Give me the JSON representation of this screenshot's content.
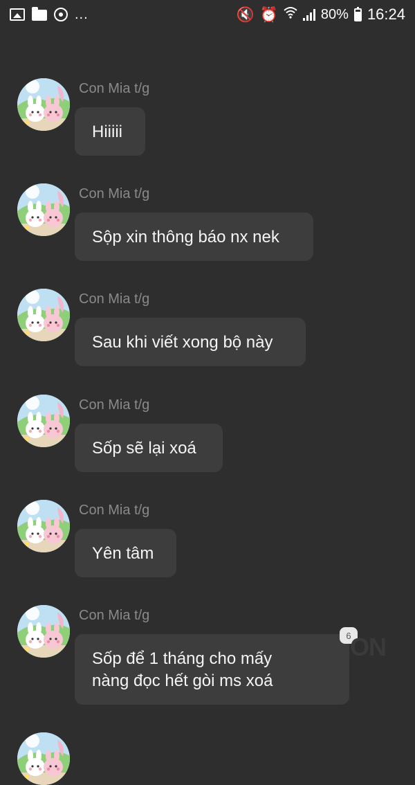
{
  "status_bar": {
    "time": "16:24",
    "battery_percent": "80%",
    "battery_level": 0.8,
    "overflow_indicator": "...",
    "left_icons": [
      "image-icon",
      "folder-icon",
      "chat-icon"
    ],
    "right_icons": [
      "mute-icon",
      "alarm-icon",
      "wifi-icon",
      "signal-icon",
      "battery-icon"
    ]
  },
  "messages": [
    {
      "sender": "Con Mia t/g",
      "text": "Hiiiii"
    },
    {
      "sender": "Con Mia t/g",
      "text": "Sộp xin thông báo nx nek"
    },
    {
      "sender": "Con Mia t/g",
      "text": "Sau khi viết xong bộ này"
    },
    {
      "sender": "Con Mia t/g",
      "text": "Sốp sẽ lại xoá"
    },
    {
      "sender": "Con Mia t/g",
      "text": "Yên tâm"
    },
    {
      "sender": "Con Mia t/g",
      "text": "Sốp để 1 tháng cho mấy\nnàng đọc hết gòi ms xoá",
      "badge": "6"
    }
  ],
  "watermark": "ON",
  "colors": {
    "background": "#2e2e2e",
    "bubble": "#3d3d3d",
    "sender": "#8a8a8a",
    "text": "#f5f5f5"
  }
}
